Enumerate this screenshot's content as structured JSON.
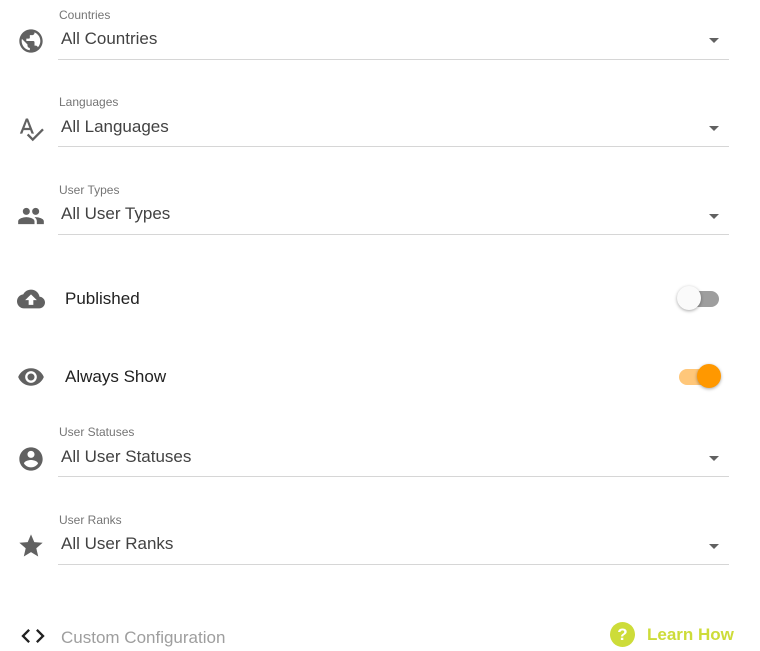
{
  "colors": {
    "accent": "#ff9800",
    "accent_light": "#ffc77a",
    "learn_how": "#cddc39",
    "off_track": "#9e9e9e",
    "off_thumb": "#fafafa"
  },
  "filters": {
    "countries": {
      "label": "Countries",
      "value": "All Countries",
      "icon": "globe-icon"
    },
    "languages": {
      "label": "Languages",
      "value": "All Languages",
      "icon": "spellcheck-icon"
    },
    "user_types": {
      "label": "User Types",
      "value": "All User Types",
      "icon": "people-icon"
    },
    "user_statuses": {
      "label": "User Statuses",
      "value": "All User Statuses",
      "icon": "account-circle-icon"
    },
    "user_ranks": {
      "label": "User Ranks",
      "value": "All User Ranks",
      "icon": "star-icon"
    }
  },
  "toggles": {
    "published": {
      "label": "Published",
      "on": false,
      "icon": "cloud-upload-icon"
    },
    "always_show": {
      "label": "Always Show",
      "on": true,
      "icon": "eye-icon"
    }
  },
  "custom_config": {
    "label": "Custom Configuration",
    "icon": "code-icon"
  },
  "learn_how": {
    "label": "Learn How",
    "icon_glyph": "?"
  }
}
